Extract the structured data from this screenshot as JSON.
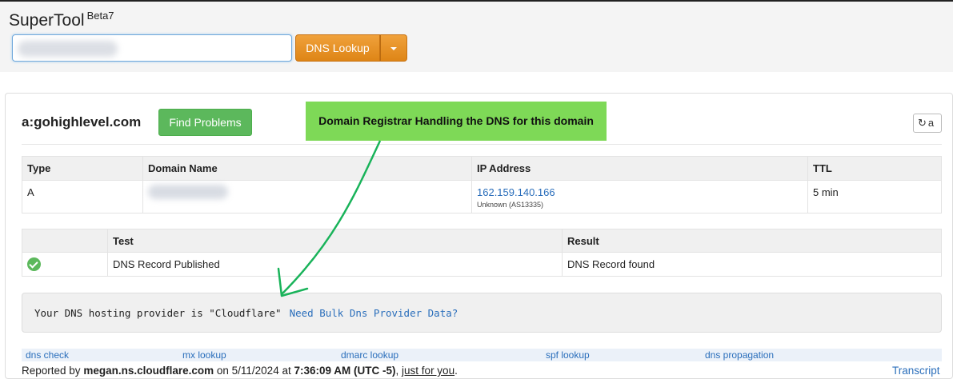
{
  "header": {
    "brand": "SuperTool",
    "beta": "Beta7",
    "search": {
      "value": "",
      "placeholder": ""
    },
    "lookup_button": "DNS Lookup"
  },
  "result": {
    "domain_title": "a:gohighlevel.com",
    "find_problems": "Find Problems",
    "annotation": "Domain Registrar Handling the DNS for this domain",
    "refresh_label": "a",
    "dns_table": {
      "headers": [
        "Type",
        "Domain Name",
        "IP Address",
        "TTL"
      ],
      "rows": [
        {
          "type": "A",
          "domain": "",
          "ip": "162.159.140.166",
          "asn": "Unknown (AS13335)",
          "ttl": "5 min"
        }
      ]
    },
    "test_table": {
      "headers": [
        "",
        "Test",
        "Result"
      ],
      "rows": [
        {
          "status": "check-icon",
          "test": "DNS Record Published",
          "result": "DNS Record found"
        }
      ]
    },
    "provider_text": "Your DNS hosting provider is \"Cloudflare\"",
    "bulk_link": "Need Bulk Dns Provider Data?"
  },
  "links": [
    "dns check",
    "mx lookup",
    "dmarc lookup",
    "spf lookup",
    "dns propagation"
  ],
  "footer": {
    "reported_by": "Reported by",
    "server": "megan.ns.cloudflare.com",
    "on": "on 5/11/2024 at",
    "time": "7:36:09 AM (UTC -5)",
    "comma": ",",
    "just_for_you": "just for you",
    "period": ".",
    "transcript": "Transcript"
  },
  "colors": {
    "brand_orange": "#e8922a",
    "success_green": "#5cb85c",
    "annotation_green": "#7ed957",
    "link_blue": "#2a6ebb",
    "arrow_green": "#19b35a"
  }
}
